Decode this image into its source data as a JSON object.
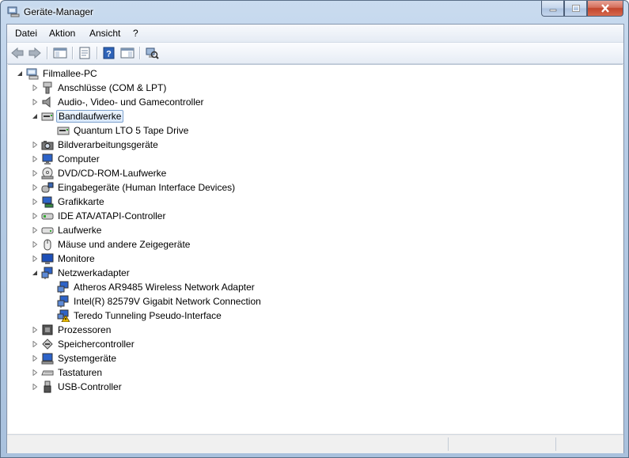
{
  "window": {
    "title": "Geräte-Manager",
    "caption_buttons": [
      "minimize",
      "maximize",
      "close"
    ]
  },
  "menu": [
    {
      "label": "Datei"
    },
    {
      "label": "Aktion"
    },
    {
      "label": "Ansicht"
    },
    {
      "label": "?"
    }
  ],
  "toolbar": {
    "buttons": [
      {
        "icon": "back-arrow-icon"
      },
      {
        "icon": "forward-arrow-icon"
      },
      {
        "icon": "show-hide-console-tree-icon"
      },
      {
        "icon": "properties-icon"
      },
      {
        "icon": "help-icon"
      },
      {
        "icon": "action-pane-icon"
      },
      {
        "icon": "scan-hardware-icon"
      }
    ]
  },
  "tree": {
    "root": {
      "label": "Filmallee-PC",
      "expanded": true,
      "icon": "computer-icon"
    },
    "categories": [
      {
        "label": "Anschlüsse (COM & LPT)",
        "expanded": false,
        "icon": "port-icon"
      },
      {
        "label": "Audio-, Video- und Gamecontroller",
        "expanded": false,
        "icon": "speaker-icon"
      },
      {
        "label": "Bandlaufwerke",
        "expanded": true,
        "selected": true,
        "icon": "tape-drive-icon",
        "children": [
          {
            "label": "Quantum LTO 5 Tape Drive",
            "icon": "tape-drive-icon",
            "warning": false
          }
        ]
      },
      {
        "label": "Bildverarbeitungsgeräte",
        "expanded": false,
        "icon": "camera-icon"
      },
      {
        "label": "Computer",
        "expanded": false,
        "icon": "monitor-icon"
      },
      {
        "label": "DVD/CD-ROM-Laufwerke",
        "expanded": false,
        "icon": "optical-drive-icon"
      },
      {
        "label": "Eingabegeräte (Human Interface Devices)",
        "expanded": false,
        "icon": "hid-icon"
      },
      {
        "label": "Grafikkarte",
        "expanded": false,
        "icon": "display-adapter-icon"
      },
      {
        "label": "IDE ATA/ATAPI-Controller",
        "expanded": false,
        "icon": "ide-controller-icon"
      },
      {
        "label": "Laufwerke",
        "expanded": false,
        "icon": "disk-drive-icon"
      },
      {
        "label": "Mäuse und andere Zeigegeräte",
        "expanded": false,
        "icon": "mouse-icon"
      },
      {
        "label": "Monitore",
        "expanded": false,
        "icon": "monitor-icon"
      },
      {
        "label": "Netzwerkadapter",
        "expanded": true,
        "icon": "network-adapter-icon",
        "children": [
          {
            "label": "Atheros AR9485 Wireless Network Adapter",
            "icon": "network-adapter-icon",
            "warning": false
          },
          {
            "label": "Intel(R) 82579V Gigabit Network Connection",
            "icon": "network-adapter-icon",
            "warning": false
          },
          {
            "label": "Teredo Tunneling Pseudo-Interface",
            "icon": "network-adapter-icon",
            "warning": true
          }
        ]
      },
      {
        "label": "Prozessoren",
        "expanded": false,
        "icon": "processor-icon"
      },
      {
        "label": "Speichercontroller",
        "expanded": false,
        "icon": "storage-controller-icon"
      },
      {
        "label": "Systemgeräte",
        "expanded": false,
        "icon": "system-device-icon"
      },
      {
        "label": "Tastaturen",
        "expanded": false,
        "icon": "keyboard-icon"
      },
      {
        "label": "USB-Controller",
        "expanded": false,
        "icon": "usb-icon"
      }
    ]
  },
  "colors": {
    "selection_border": "#7da2ce",
    "selection_fill": "#d9e8fb",
    "close_button": "#c2452d",
    "warning": "#f2c200"
  }
}
